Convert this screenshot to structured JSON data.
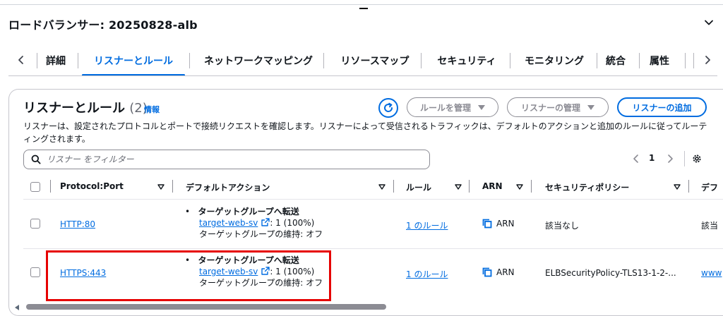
{
  "page": {
    "title": "ロードバランサー: 20250828-alb"
  },
  "tabs": [
    {
      "label": "詳細"
    },
    {
      "label": "リスナーとルール"
    },
    {
      "label": "ネットワークマッピング"
    },
    {
      "label": "リソースマップ"
    },
    {
      "label": "セキュリティ"
    },
    {
      "label": "モニタリング"
    },
    {
      "label": "統合"
    },
    {
      "label": "属性"
    }
  ],
  "active_tab": "リスナーとルール",
  "panel": {
    "title": "リスナーとルール",
    "count": "(2)",
    "info_link": "情報",
    "description": "リスナーは、設定されたプロトコルとポートで接続リクエストを確認します。リスナーによって受信されるトラフィックは、デフォルトのアクションと追加のルールに従ってルーティングされます。",
    "buttons": {
      "manage_rules": "ルールを管理",
      "manage_listeners": "リスナーの管理",
      "add_listener": "リスナーの追加"
    },
    "search": {
      "placeholder": "リスナー をフィルター"
    },
    "pagination": {
      "current_page": "1"
    }
  },
  "table": {
    "columns": {
      "protocol_port": "Protocol:Port",
      "default_action": "デフォルトアクション",
      "rules": "ルール",
      "arn": "ARN",
      "security_policy": "セキュリティポリシー",
      "truncated": "デフ"
    },
    "rows": [
      {
        "protocol_port": "HTTP:80",
        "action_title": "ターゲットグループへ転送",
        "target_group": "target-web-sv",
        "weight": ": 1 (100%)",
        "stickiness": "ターゲットグループの維持: オフ",
        "rules": "1 のルール",
        "arn": "ARN",
        "security_policy": "該当なし",
        "truncated": "該当"
      },
      {
        "protocol_port": "HTTPS:443",
        "action_title": "ターゲットグループへ転送",
        "target_group": "target-web-sv",
        "weight": ": 1 (100%)",
        "stickiness": "ターゲットグループの維持: オフ",
        "rules": "1 のルール",
        "arn": "ARN",
        "security_policy": "ELBSecurityPolicy-TLS13-1-2-...",
        "truncated": "www"
      }
    ]
  },
  "colors": {
    "accent": "#006ce0",
    "text": "#0f141a",
    "border": "#c6c6cd",
    "highlight": "#e60000"
  },
  "icons": [
    "chevron-down-icon",
    "chevron-left-icon",
    "chevron-right-icon",
    "refresh-icon",
    "caret-down-icon",
    "search-icon",
    "settings-icon",
    "sort-icon",
    "external-link-icon",
    "copy-icon"
  ]
}
